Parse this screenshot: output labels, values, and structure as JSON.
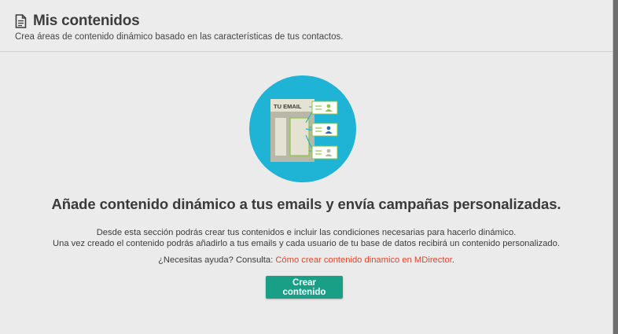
{
  "header": {
    "title": "Mis contenidos",
    "subtitle": "Crea áreas de contenido dinámico basado en las características de tus contactos.",
    "icon": "document-icon"
  },
  "illustration": {
    "email_label": "TU EMAIL",
    "circle_color": "#1fb3d6"
  },
  "main": {
    "headline": "Añade contenido dinámico a tus emails y envía campañas personalizadas.",
    "description_line1": "Desde esta sección podrás crear tus contenidos e incluir las condiciones necesarias para hacerlo dinámico.",
    "description_line2": "Una vez creado el contenido podrás añadirlo a tus emails y cada usuario de tu base de datos recibirá un contenido personalizado.",
    "help_prefix": "¿Necesitas ayuda? Consulta: ",
    "help_link": "Cómo crear contenido dinamico en MDirector",
    "help_suffix": ".",
    "link_color": "#e0452a",
    "button_label": "Crear contenido",
    "button_color": "#189f86"
  }
}
